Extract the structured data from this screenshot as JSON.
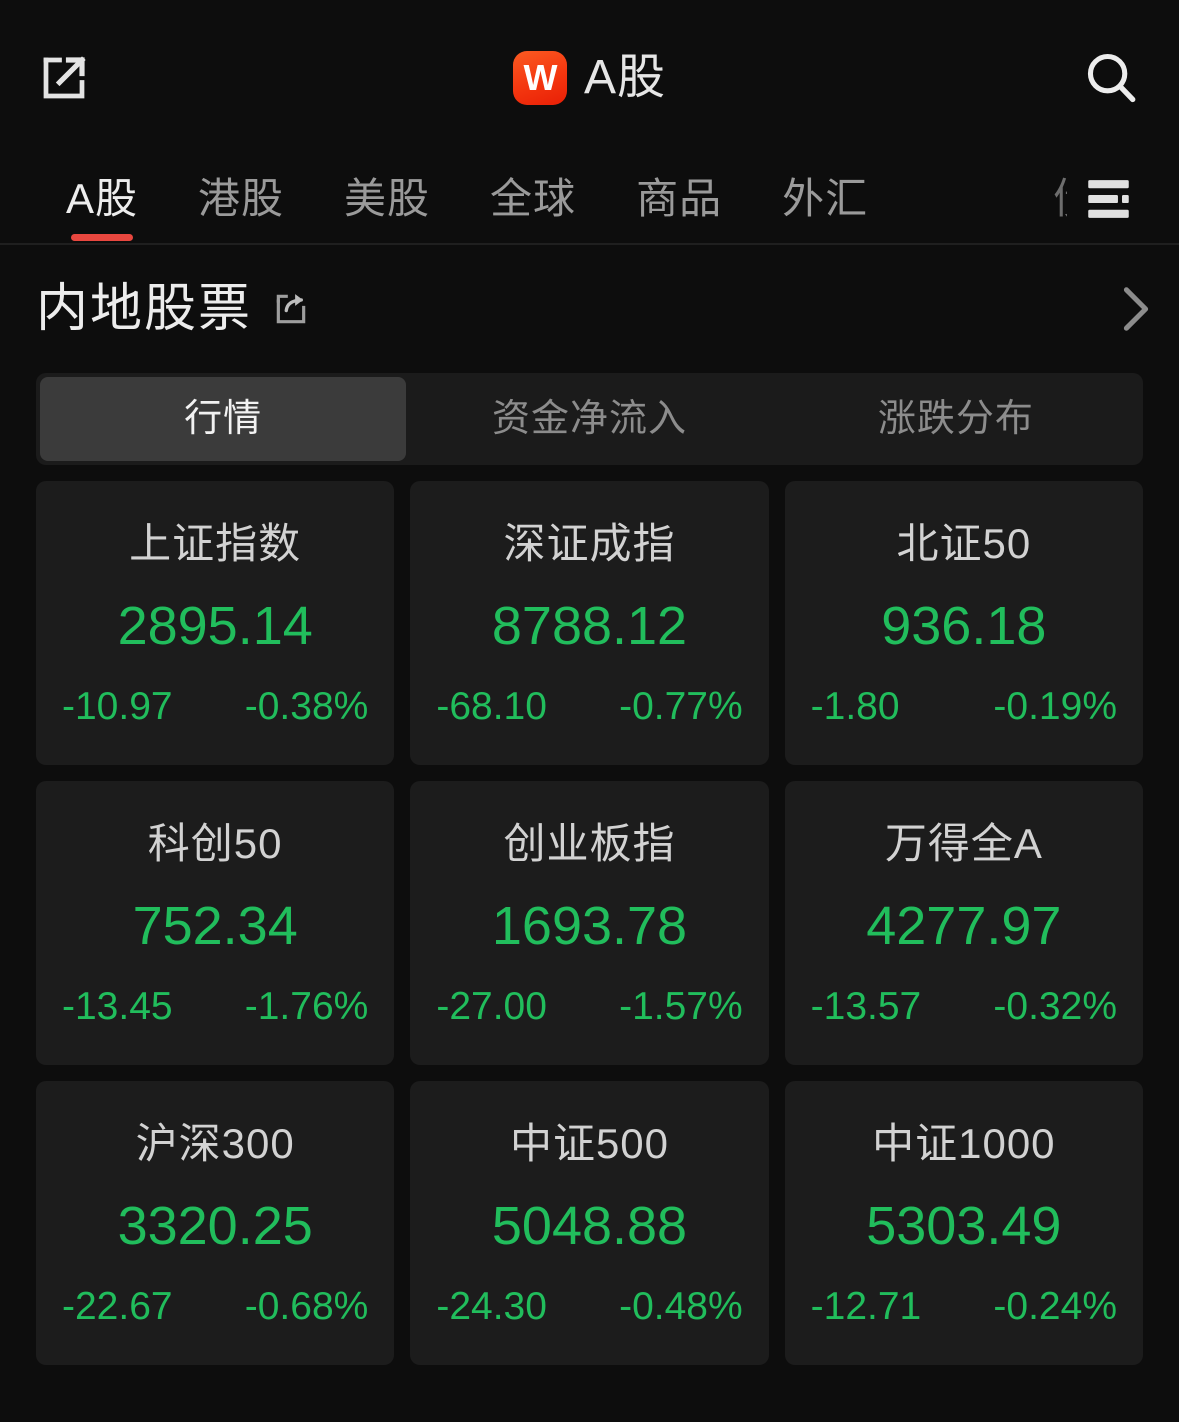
{
  "header": {
    "share_icon": "external-link-icon",
    "brand_letter": "W",
    "title": "A股",
    "search_icon": "search-icon"
  },
  "tabs": {
    "items": [
      {
        "label": "A股",
        "active": true
      },
      {
        "label": "港股",
        "active": false
      },
      {
        "label": "美股",
        "active": false
      },
      {
        "label": "全球",
        "active": false
      },
      {
        "label": "商品",
        "active": false
      },
      {
        "label": "外汇",
        "active": false
      }
    ],
    "clipped_label": "债",
    "menu_icon": "list-menu-icon",
    "active_indicator_color": "#e8473f"
  },
  "section": {
    "title": "内地股票",
    "share_icon": "share-icon",
    "chevron_icon": "chevron-right-icon"
  },
  "segmented": {
    "items": [
      {
        "label": "行情",
        "active": true
      },
      {
        "label": "资金净流入",
        "active": false
      },
      {
        "label": "涨跌分布",
        "active": false
      }
    ]
  },
  "colors": {
    "down": "#21bd5c",
    "up": "#e8473f",
    "page_bg": "#0d0d0d",
    "card_bg": "#1c1c1c",
    "accent": "#e8473f"
  },
  "indices": [
    {
      "name": "上证指数",
      "value": "2895.14",
      "change": "-10.97",
      "percent": "-0.38%",
      "dir": "down"
    },
    {
      "name": "深证成指",
      "value": "8788.12",
      "change": "-68.10",
      "percent": "-0.77%",
      "dir": "down"
    },
    {
      "name": "北证50",
      "value": "936.18",
      "change": "-1.80",
      "percent": "-0.19%",
      "dir": "down"
    },
    {
      "name": "科创50",
      "value": "752.34",
      "change": "-13.45",
      "percent": "-1.76%",
      "dir": "down"
    },
    {
      "name": "创业板指",
      "value": "1693.78",
      "change": "-27.00",
      "percent": "-1.57%",
      "dir": "down"
    },
    {
      "name": "万得全A",
      "value": "4277.97",
      "change": "-13.57",
      "percent": "-0.32%",
      "dir": "down"
    },
    {
      "name": "沪深300",
      "value": "3320.25",
      "change": "-22.67",
      "percent": "-0.68%",
      "dir": "down"
    },
    {
      "name": "中证500",
      "value": "5048.88",
      "change": "-24.30",
      "percent": "-0.48%",
      "dir": "down"
    },
    {
      "name": "中证1000",
      "value": "5303.49",
      "change": "-12.71",
      "percent": "-0.24%",
      "dir": "down"
    }
  ]
}
